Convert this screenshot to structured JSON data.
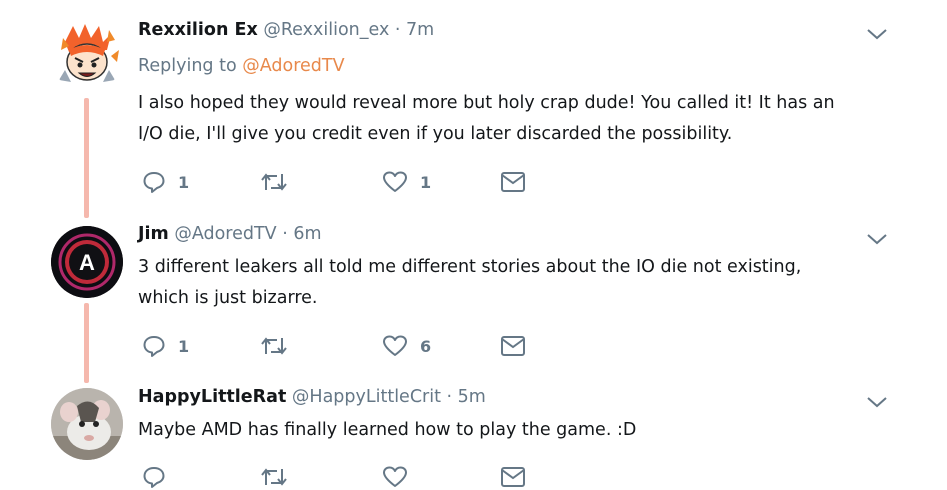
{
  "tweets": [
    {
      "name": "Rexxilion Ex",
      "handle": "@Rexxilion_ex",
      "time": "· 7m",
      "reply_prefix": "Replying to ",
      "reply_handle": "@AdoredTV",
      "lines": [
        "I also hoped they would reveal more but holy crap dude! You called it! It has an",
        "I/O die, I'll give you credit even if you later discarded the possibility."
      ],
      "replies": "1",
      "retweets": "",
      "likes": "1",
      "avatar": "cartoon-character-avatar"
    },
    {
      "name": "Jim",
      "handle": "@AdoredTV",
      "time": "· 6m",
      "lines": [
        "3 different leakers all told me different stories about the IO die not existing,",
        "which is just bizarre."
      ],
      "replies": "1",
      "retweets": "",
      "likes": "6",
      "avatar_letter": "A"
    },
    {
      "name": "HappyLittleRat",
      "handle": "@HappyLittleCrit",
      "time": "· 5m",
      "lines": [
        "Maybe AMD has finally learned how to play the game. :D"
      ],
      "replies": "",
      "retweets": "",
      "likes": "",
      "avatar": "rat-photo-avatar"
    }
  ],
  "colors": {
    "thread_line": "#f5b8ad",
    "reply_link": "#e8894b",
    "meta_text": "#657786"
  }
}
